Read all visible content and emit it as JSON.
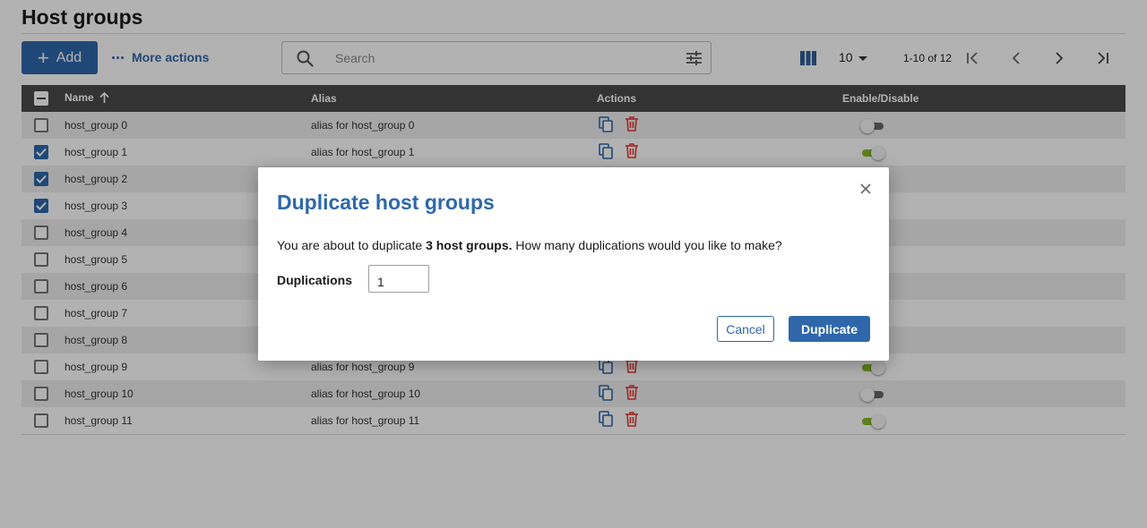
{
  "page": {
    "title": "Host groups"
  },
  "toolbar": {
    "add_label": "Add",
    "more_actions_label": "More actions"
  },
  "search": {
    "placeholder": "Search",
    "value": ""
  },
  "pagination": {
    "per_page": "10",
    "range": "1-10 of 12"
  },
  "table": {
    "columns": {
      "name": "Name",
      "alias": "Alias",
      "actions": "Actions",
      "enable": "Enable/Disable"
    },
    "rows": [
      {
        "name": "host_group 0",
        "alias": "alias for host_group 0",
        "selected": false,
        "enabled": false
      },
      {
        "name": "host_group 1",
        "alias": "alias for host_group 1",
        "selected": true,
        "enabled": true
      },
      {
        "name": "host_group 2",
        "alias": "",
        "selected": true,
        "enabled": null
      },
      {
        "name": "host_group 3",
        "alias": "",
        "selected": true,
        "enabled": null
      },
      {
        "name": "host_group 4",
        "alias": "",
        "selected": false,
        "enabled": null
      },
      {
        "name": "host_group 5",
        "alias": "",
        "selected": false,
        "enabled": null
      },
      {
        "name": "host_group 6",
        "alias": "",
        "selected": false,
        "enabled": null
      },
      {
        "name": "host_group 7",
        "alias": "",
        "selected": false,
        "enabled": null
      },
      {
        "name": "host_group 8",
        "alias": "",
        "selected": false,
        "enabled": null
      },
      {
        "name": "host_group 9",
        "alias": "alias for host_group 9",
        "selected": false,
        "enabled": true
      },
      {
        "name": "host_group 10",
        "alias": "alias for host_group 10",
        "selected": false,
        "enabled": false
      },
      {
        "name": "host_group 11",
        "alias": "alias for host_group 11",
        "selected": false,
        "enabled": true
      }
    ]
  },
  "modal": {
    "title": "Duplicate host groups",
    "message_prefix": "You are about to duplicate ",
    "message_bold": "3 host groups.",
    "message_suffix": " How many duplications would you like to make?",
    "field_label": "Duplications",
    "field_value": "1",
    "cancel_label": "Cancel",
    "confirm_label": "Duplicate"
  },
  "colors": {
    "primary": "#2e68aa",
    "header_bg": "#4a4a4a",
    "toggle_on": "#84b92a",
    "delete_red": "#e53935"
  },
  "icons": {
    "add": "plus-icon",
    "more": "dots-icon",
    "search": "search-icon",
    "filter": "filter-icon",
    "columns": "columns-icon",
    "duplicate": "duplicate-icon",
    "delete": "trash-icon",
    "close": "close-icon"
  }
}
